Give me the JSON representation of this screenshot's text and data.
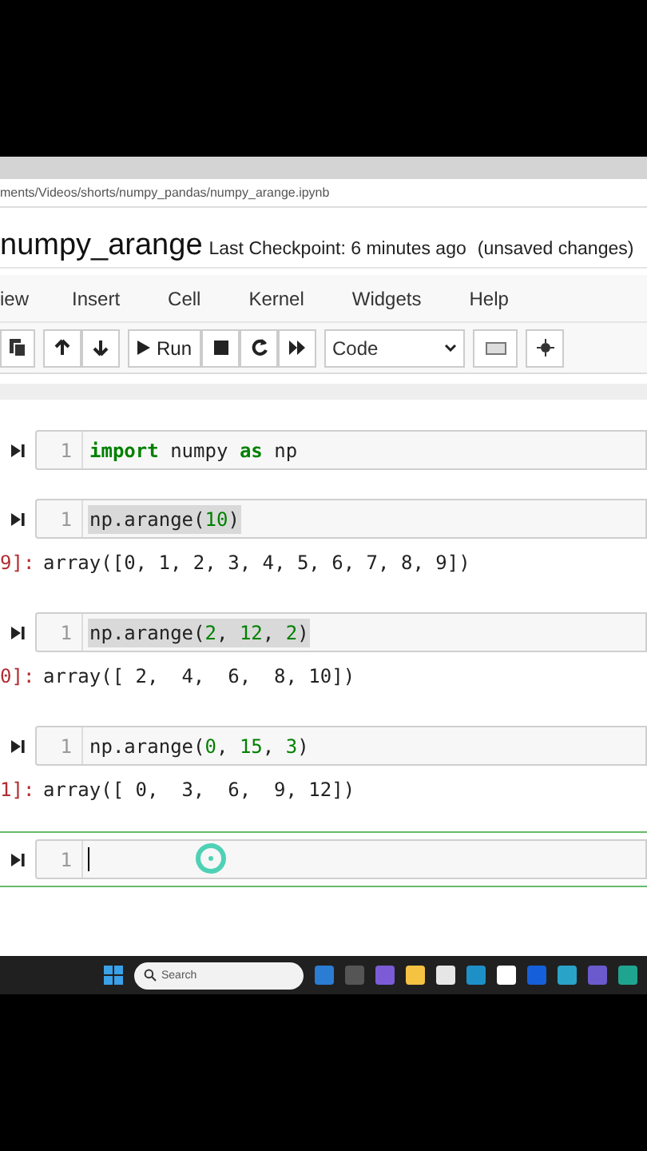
{
  "address_bar": {
    "url": "ments/Videos/shorts/numpy_pandas/numpy_arange.ipynb"
  },
  "header": {
    "notebook_name": "numpy_arange",
    "checkpoint": "Last Checkpoint: 6 minutes ago",
    "status": "(unsaved changes)"
  },
  "menu": [
    "iew",
    "Insert",
    "Cell",
    "Kernel",
    "Widgets",
    "Help"
  ],
  "toolbar": {
    "run_label": "Run",
    "cell_type": "Code"
  },
  "cells": [
    {
      "selected": false,
      "highlighted": false,
      "line_number": "1",
      "tokens": [
        {
          "kind": "keyword",
          "text": "import"
        },
        {
          "kind": "text",
          "text": " numpy "
        },
        {
          "kind": "keyword",
          "text": "as"
        },
        {
          "kind": "text",
          "text": " np"
        }
      ]
    },
    {
      "selected": false,
      "highlighted": true,
      "line_number": "1",
      "tokens": [
        {
          "kind": "text",
          "text": "np.arange("
        },
        {
          "kind": "number",
          "text": "10"
        },
        {
          "kind": "text",
          "text": ")"
        }
      ],
      "output": {
        "prompt": "9]:",
        "text": "array([0, 1, 2, 3, 4, 5, 6, 7, 8, 9])"
      }
    },
    {
      "selected": false,
      "highlighted": true,
      "line_number": "1",
      "tokens": [
        {
          "kind": "text",
          "text": "np.arange("
        },
        {
          "kind": "number",
          "text": "2"
        },
        {
          "kind": "text",
          "text": ", "
        },
        {
          "kind": "number",
          "text": "12"
        },
        {
          "kind": "text",
          "text": ", "
        },
        {
          "kind": "number",
          "text": "2"
        },
        {
          "kind": "text",
          "text": ")"
        }
      ],
      "output": {
        "prompt": "0]:",
        "text": "array([ 2,  4,  6,  8, 10])"
      }
    },
    {
      "selected": false,
      "highlighted": false,
      "line_number": "1",
      "tokens": [
        {
          "kind": "text",
          "text": "np.arange("
        },
        {
          "kind": "number",
          "text": "0"
        },
        {
          "kind": "text",
          "text": ", "
        },
        {
          "kind": "number",
          "text": "15"
        },
        {
          "kind": "text",
          "text": ", "
        },
        {
          "kind": "number",
          "text": "3"
        },
        {
          "kind": "text",
          "text": ")"
        }
      ],
      "output": {
        "prompt": "1]:",
        "text": "array([ 0,  3,  6,  9, 12])"
      }
    },
    {
      "selected": true,
      "line_number": "1"
    }
  ],
  "taskbar": {
    "search_placeholder": "Search"
  }
}
